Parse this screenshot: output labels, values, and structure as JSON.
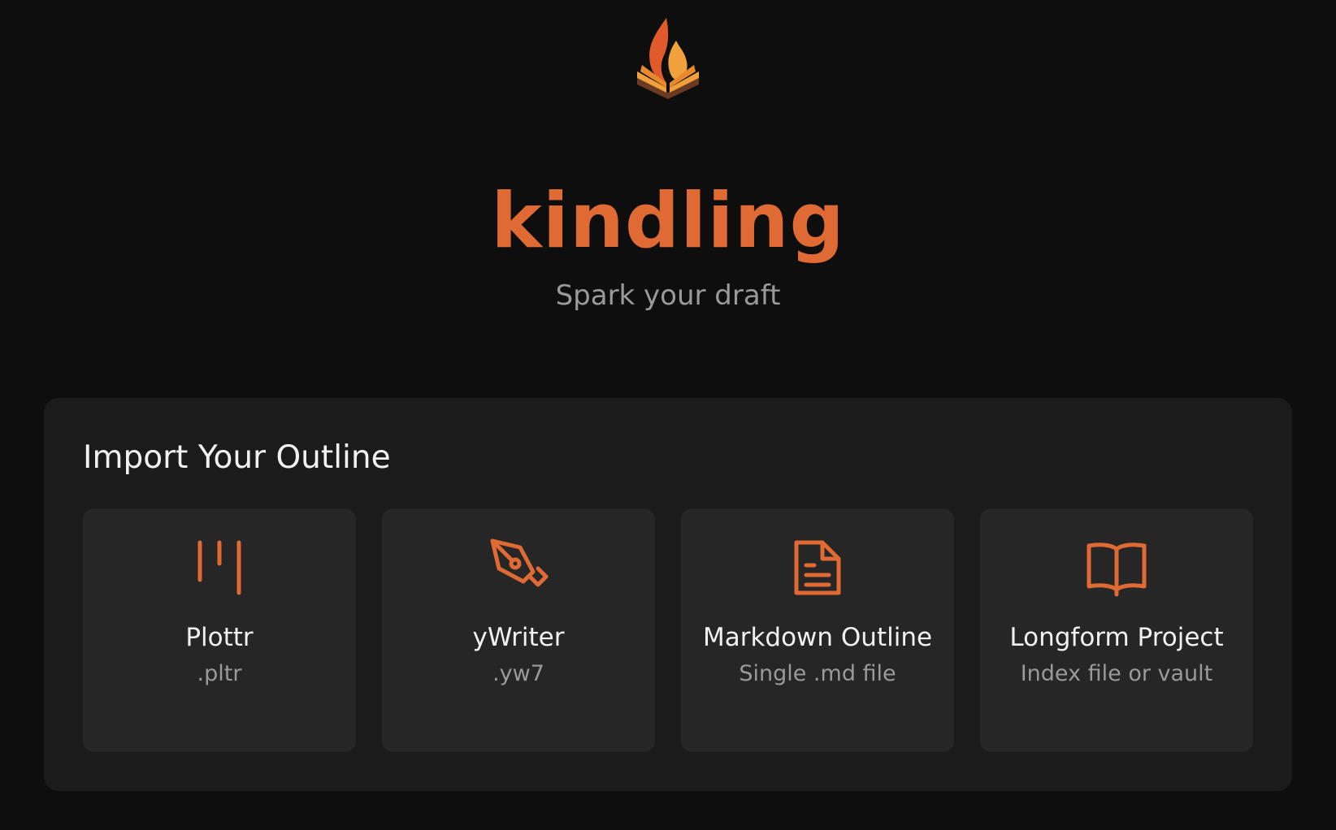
{
  "app": {
    "name": "kindling",
    "tagline": "Spark your draft"
  },
  "colors": {
    "accent": "#e06a33",
    "background": "#0e0e0e",
    "panel": "#1b1b1b",
    "card": "#262626",
    "text_primary": "#f1f1f1",
    "text_secondary": "#9a9a9a"
  },
  "import_panel": {
    "title": "Import Your Outline",
    "cards": [
      {
        "label": "Plottr",
        "sub": ".pltr",
        "icon": "columns-icon"
      },
      {
        "label": "yWriter",
        "sub": ".yw7",
        "icon": "pen-nib-icon"
      },
      {
        "label": "Markdown Outline",
        "sub": "Single .md file",
        "icon": "document-icon"
      },
      {
        "label": "Longform Project",
        "sub": "Index file or vault",
        "icon": "open-book-icon"
      }
    ]
  }
}
